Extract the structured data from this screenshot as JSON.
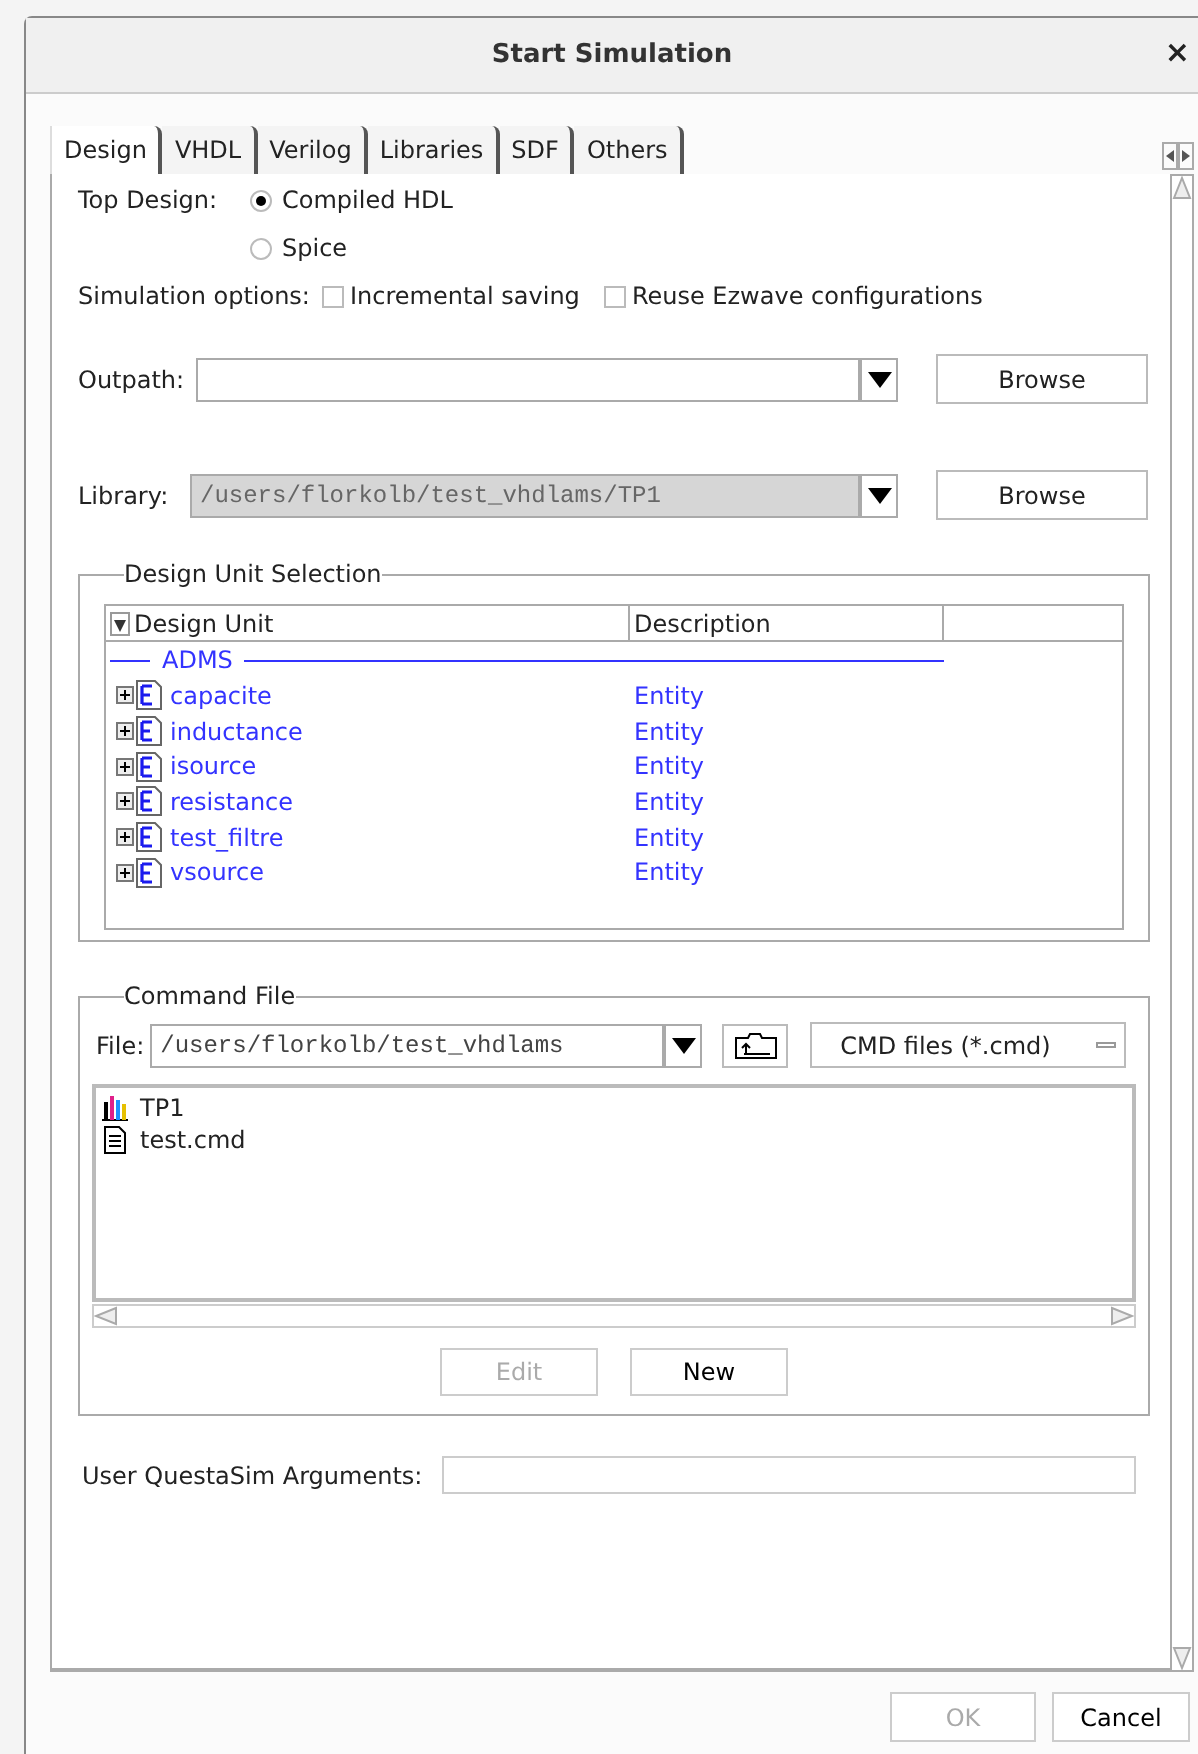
{
  "window": {
    "title": "Start Simulation",
    "close": "×"
  },
  "tabs": [
    {
      "label": "Design",
      "selected": true
    },
    {
      "label": "VHDL",
      "selected": false
    },
    {
      "label": "Verilog",
      "selected": false
    },
    {
      "label": "Libraries",
      "selected": false
    },
    {
      "label": "SDF",
      "selected": false
    },
    {
      "label": "Others",
      "selected": false
    }
  ],
  "top_design": {
    "label": "Top Design:",
    "options": [
      {
        "label": "Compiled HDL",
        "selected": true
      },
      {
        "label": "Spice",
        "selected": false
      }
    ]
  },
  "simulation_options": {
    "label": "Simulation options:",
    "checkboxes": [
      {
        "label": "Incremental saving",
        "checked": false
      },
      {
        "label": "Reuse Ezwave configurations",
        "checked": false
      }
    ]
  },
  "outpath": {
    "label": "Outpath:",
    "disabled": false,
    "button": "Browse"
  },
  "library": {
    "label": "Library:",
    "value": "/users/florkolb/test_vhdlams/TP1",
    "disabled": true,
    "button": "Browse"
  },
  "design_unit_selection": {
    "title": "Design Unit Selection",
    "columns": [
      "Design Unit",
      "Description"
    ],
    "group": "ADMS",
    "rows": [
      {
        "name": "capacite",
        "description": "Entity"
      },
      {
        "name": "inductance",
        "description": "Entity"
      },
      {
        "name": "isource",
        "description": "Entity"
      },
      {
        "name": "resistance",
        "description": "Entity"
      },
      {
        "name": "test_filtre",
        "description": "Entity"
      },
      {
        "name": "vsource",
        "description": "Entity"
      }
    ]
  },
  "command_file": {
    "title": "Command File",
    "file_label": "File:",
    "path": "/users/florkolb/test_vhdlams",
    "filter": "CMD files (*.cmd)",
    "files": [
      {
        "name": "TP1",
        "kind": "simulation"
      },
      {
        "name": "test.cmd",
        "kind": "document"
      }
    ],
    "buttons": [
      {
        "label": "Edit",
        "disabled": true
      },
      {
        "label": "New",
        "disabled": false
      }
    ]
  },
  "arguments": {
    "label": "User QuestaSim Arguments:"
  },
  "buttons": [
    {
      "label": "OK",
      "disabled": true
    },
    {
      "label": "Cancel",
      "disabled": false
    }
  ]
}
